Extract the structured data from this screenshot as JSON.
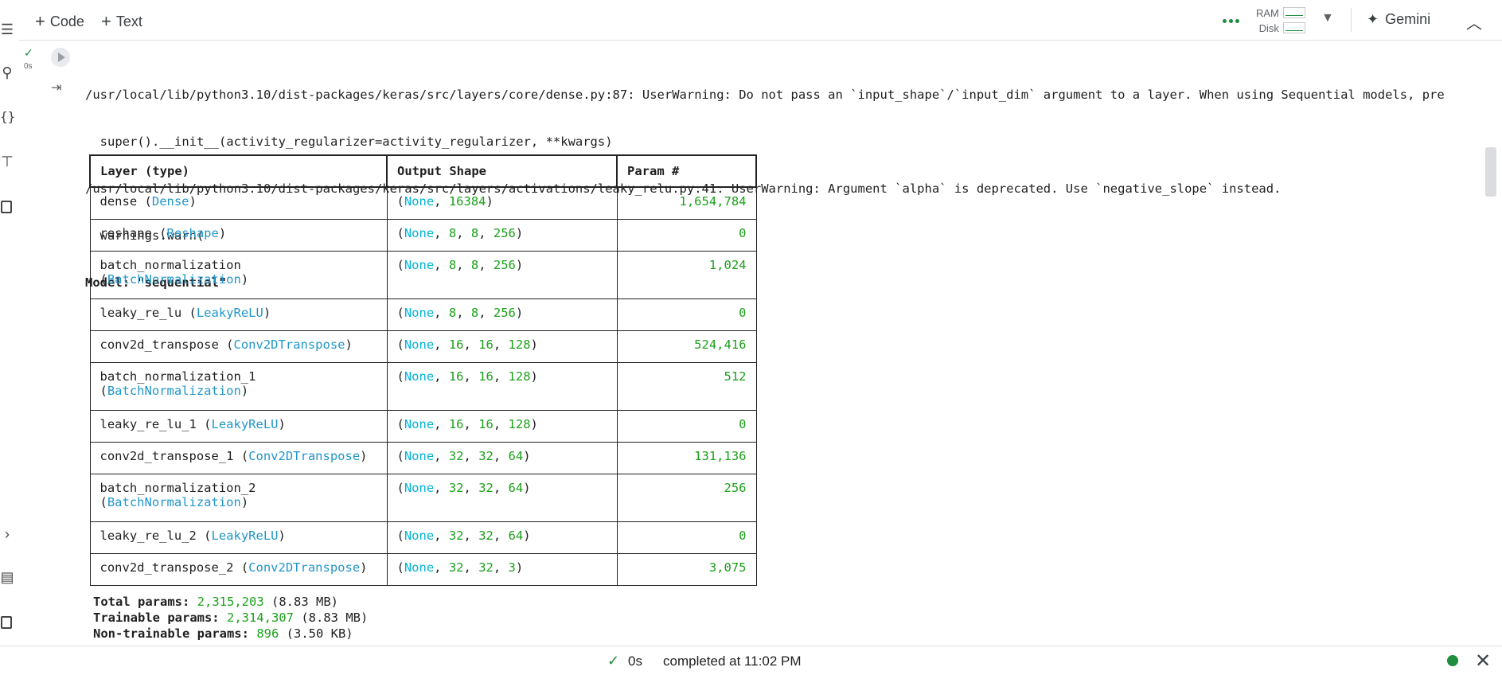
{
  "toolbar": {
    "code_label": "Code",
    "text_label": "Text",
    "ram_label": "RAM",
    "disk_label": "Disk",
    "gemini_label": "Gemini"
  },
  "cell": {
    "exec_time": "0s"
  },
  "output": {
    "warning1": "/usr/local/lib/python3.10/dist-packages/keras/src/layers/core/dense.py:87: UserWarning: Do not pass an `input_shape`/`input_dim` argument to a layer. When using Sequential models, pre",
    "warning1_cont": "  super().__init__(activity_regularizer=activity_regularizer, **kwargs)",
    "warning2": "/usr/local/lib/python3.10/dist-packages/keras/src/layers/activations/leaky_relu.py:41: UserWarning: Argument `alpha` is deprecated. Use `negative_slope` instead.",
    "warning2_cont": "  warnings.warn(",
    "model_title": "Model: \"sequential\""
  },
  "summary": {
    "headers": {
      "layer": "Layer (type)",
      "output": "Output Shape",
      "param": "Param #"
    },
    "rows": [
      {
        "name": "dense",
        "type": "Dense",
        "shape": [
          "16384"
        ],
        "params": "1,654,784",
        "wrap": false
      },
      {
        "name": "reshape",
        "type": "Reshape",
        "shape": [
          "8",
          "8",
          "256"
        ],
        "params": "0",
        "wrap": false
      },
      {
        "name": "batch_normalization",
        "type": "BatchNormalization",
        "shape": [
          "8",
          "8",
          "256"
        ],
        "params": "1,024",
        "wrap": true
      },
      {
        "name": "leaky_re_lu",
        "type": "LeakyReLU",
        "shape": [
          "8",
          "8",
          "256"
        ],
        "params": "0",
        "wrap": false
      },
      {
        "name": "conv2d_transpose",
        "type": "Conv2DTranspose",
        "shape": [
          "16",
          "16",
          "128"
        ],
        "params": "524,416",
        "wrap": false
      },
      {
        "name": "batch_normalization_1",
        "type": "BatchNormalization",
        "shape": [
          "16",
          "16",
          "128"
        ],
        "params": "512",
        "wrap": true
      },
      {
        "name": "leaky_re_lu_1",
        "type": "LeakyReLU",
        "shape": [
          "16",
          "16",
          "128"
        ],
        "params": "0",
        "wrap": false
      },
      {
        "name": "conv2d_transpose_1",
        "type": "Conv2DTranspose",
        "shape": [
          "32",
          "32",
          "64"
        ],
        "params": "131,136",
        "wrap": false
      },
      {
        "name": "batch_normalization_2",
        "type": "BatchNormalization",
        "shape": [
          "32",
          "32",
          "64"
        ],
        "params": "256",
        "wrap": true
      },
      {
        "name": "leaky_re_lu_2",
        "type": "LeakyReLU",
        "shape": [
          "32",
          "32",
          "64"
        ],
        "params": "0",
        "wrap": false
      },
      {
        "name": "conv2d_transpose_2",
        "type": "Conv2DTranspose",
        "shape": [
          "32",
          "32",
          "3"
        ],
        "params": "3,075",
        "wrap": false
      }
    ],
    "none_label": "None",
    "totals": [
      {
        "label": "Total params:",
        "value": "2,315,203",
        "size": "(8.83 MB)"
      },
      {
        "label": "Trainable params:",
        "value": "2,314,307",
        "size": "(8.83 MB)"
      },
      {
        "label": "Non-trainable params:",
        "value": "896",
        "size": "(3.50 KB)"
      }
    ]
  },
  "status": {
    "time": "0s",
    "completed": "completed at 11:02 PM"
  }
}
